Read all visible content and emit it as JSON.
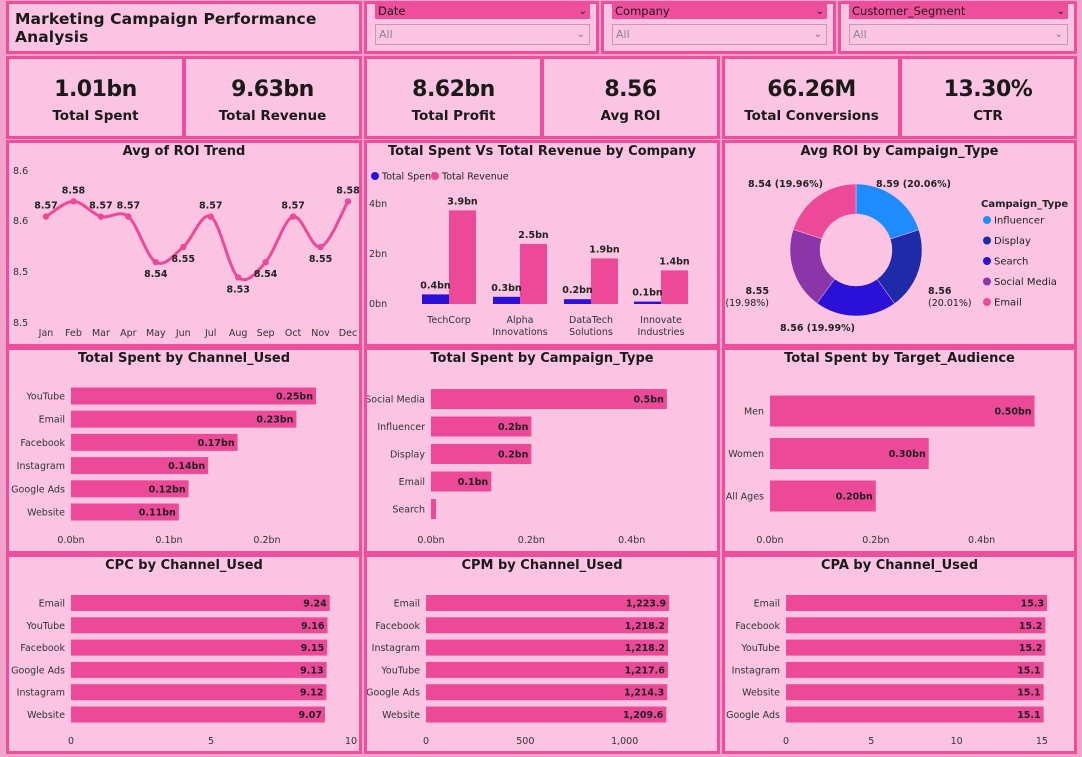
{
  "header": {
    "title": "Marketing Campaign Performance Analysis"
  },
  "filters": [
    {
      "label": "Date",
      "value": "All"
    },
    {
      "label": "Company",
      "value": "All"
    },
    {
      "label": "Customer_Segment",
      "value": "All"
    }
  ],
  "kpis": [
    {
      "value": "1.01bn",
      "label": "Total Spent"
    },
    {
      "value": "9.63bn",
      "label": "Total Revenue"
    },
    {
      "value": "8.62bn",
      "label": "Total Profit"
    },
    {
      "value": "8.56",
      "label": "Avg ROI"
    },
    {
      "value": "66.26M",
      "label": "Total Conversions"
    },
    {
      "value": "13.30%",
      "label": "CTR"
    }
  ],
  "colors": {
    "pink": "#ec4a98",
    "navy": "#1f2aa8",
    "blue": "#1e8bff",
    "indigo": "#2b10d8",
    "purple": "#8a35a8"
  },
  "chart_data": [
    {
      "type": "line",
      "title": "Avg of ROI Trend",
      "categories": [
        "Jan",
        "Feb",
        "Mar",
        "Apr",
        "May",
        "Jun",
        "Jul",
        "Aug",
        "Sep",
        "Oct",
        "Nov",
        "Dec"
      ],
      "values": [
        8.57,
        8.58,
        8.57,
        8.57,
        8.54,
        8.55,
        8.57,
        8.53,
        8.54,
        8.57,
        8.55,
        8.58
      ],
      "data_labels": [
        "8.57",
        "8.58",
        "8.57",
        "8.57",
        "8.54",
        "8.55",
        "8.57",
        "8.53",
        "8.54",
        "8.57",
        "8.55",
        "8.58"
      ],
      "yticks": [
        "8.5",
        "8.5",
        "8.6",
        "8.6"
      ],
      "ylim": [
        8.5,
        8.6
      ]
    },
    {
      "type": "bar",
      "title": "Total Spent Vs Total Revenue by Company",
      "categories": [
        "TechCorp",
        "Alpha Innovations",
        "DataTech Solutions",
        "Innovate Industries"
      ],
      "series": [
        {
          "name": "Total Spent",
          "values": [
            0.4,
            0.3,
            0.2,
            0.1
          ],
          "labels": [
            "0.4bn",
            "0.3bn",
            "0.2bn",
            "0.1bn"
          ]
        },
        {
          "name": "Total Revenue",
          "values": [
            3.9,
            2.5,
            1.9,
            1.4
          ],
          "labels": [
            "3.9bn",
            "2.5bn",
            "1.9bn",
            "1.4bn"
          ]
        }
      ],
      "yticks": [
        "0bn",
        "2bn",
        "4bn"
      ],
      "ylim": [
        0,
        4.5
      ]
    },
    {
      "type": "pie",
      "title": "Avg ROI by Campaign_Type",
      "legend_title": "Campaign_Type",
      "slices": [
        {
          "name": "Influencer",
          "value": 8.59,
          "label": "8.59 (20.06%)"
        },
        {
          "name": "Display",
          "value": 8.56,
          "label": "8.56 (20.01%)"
        },
        {
          "name": "Search",
          "value": 8.56,
          "label": "8.56 (19.99%)"
        },
        {
          "name": "Social Media",
          "value": 8.55,
          "label": "8.55 (19.98%)"
        },
        {
          "name": "Email",
          "value": 8.54,
          "label": "8.54 (19.96%)"
        }
      ]
    },
    {
      "type": "bar",
      "title": "Total Spent by Channel_Used",
      "categories": [
        "YouTube",
        "Email",
        "Facebook",
        "Instagram",
        "Google Ads",
        "Website"
      ],
      "values": [
        0.25,
        0.23,
        0.17,
        0.14,
        0.12,
        0.11
      ],
      "data_labels": [
        "0.25bn",
        "0.23bn",
        "0.17bn",
        "0.14bn",
        "0.12bn",
        "0.11bn"
      ],
      "xticks": [
        "0.0bn",
        "0.1bn",
        "0.2bn"
      ],
      "xlim": [
        0,
        0.3
      ]
    },
    {
      "type": "bar",
      "title": "Total Spent by Campaign_Type",
      "categories": [
        "Social Media",
        "Influencer",
        "Display",
        "Email",
        "Search"
      ],
      "values": [
        0.47,
        0.2,
        0.2,
        0.12,
        0.01
      ],
      "data_labels": [
        "0.5bn",
        "0.2bn",
        "0.2bn",
        "0.1bn",
        ""
      ],
      "xticks": [
        "0.0bn",
        "0.2bn",
        "0.4bn"
      ],
      "xlim": [
        0,
        0.55
      ]
    },
    {
      "type": "bar",
      "title": "Total Spent by Target_Audience",
      "categories": [
        "Men",
        "Women",
        "All Ages"
      ],
      "values": [
        0.5,
        0.3,
        0.2
      ],
      "data_labels": [
        "0.50bn",
        "0.30bn",
        "0.20bn"
      ],
      "xticks": [
        "0.0bn",
        "0.2bn",
        "0.4bn"
      ],
      "xlim": [
        0,
        0.55
      ]
    },
    {
      "type": "bar",
      "title": "CPC by Channel_Used",
      "categories": [
        "Email",
        "YouTube",
        "Facebook",
        "Google Ads",
        "Instagram",
        "Website"
      ],
      "values": [
        9.24,
        9.16,
        9.15,
        9.13,
        9.12,
        9.07
      ],
      "data_labels": [
        "9.24",
        "9.16",
        "9.15",
        "9.13",
        "9.12",
        "9.07"
      ],
      "xticks": [
        "0",
        "5",
        "10"
      ],
      "xlim": [
        0,
        10
      ]
    },
    {
      "type": "bar",
      "title": "CPM by Channel_Used",
      "categories": [
        "Email",
        "Facebook",
        "Instagram",
        "YouTube",
        "Google Ads",
        "Website"
      ],
      "values": [
        1223.9,
        1218.2,
        1218.2,
        1217.6,
        1214.3,
        1209.6
      ],
      "data_labels": [
        "1,223.9",
        "1,218.2",
        "1,218.2",
        "1,217.6",
        "1,214.3",
        "1,209.6"
      ],
      "xticks": [
        "0",
        "500",
        "1,000"
      ],
      "xlim": [
        0,
        1500
      ]
    },
    {
      "type": "bar",
      "title": "CPA by Channel_Used",
      "categories": [
        "Email",
        "Facebook",
        "YouTube",
        "Instagram",
        "Website",
        "Google Ads"
      ],
      "values": [
        15.3,
        15.2,
        15.2,
        15.1,
        15.1,
        15.1
      ],
      "data_labels": [
        "15.3",
        "15.2",
        "15.2",
        "15.1",
        "15.1",
        "15.1"
      ],
      "xticks": [
        "0",
        "5",
        "10",
        "15"
      ],
      "xlim": [
        0,
        16
      ]
    }
  ]
}
